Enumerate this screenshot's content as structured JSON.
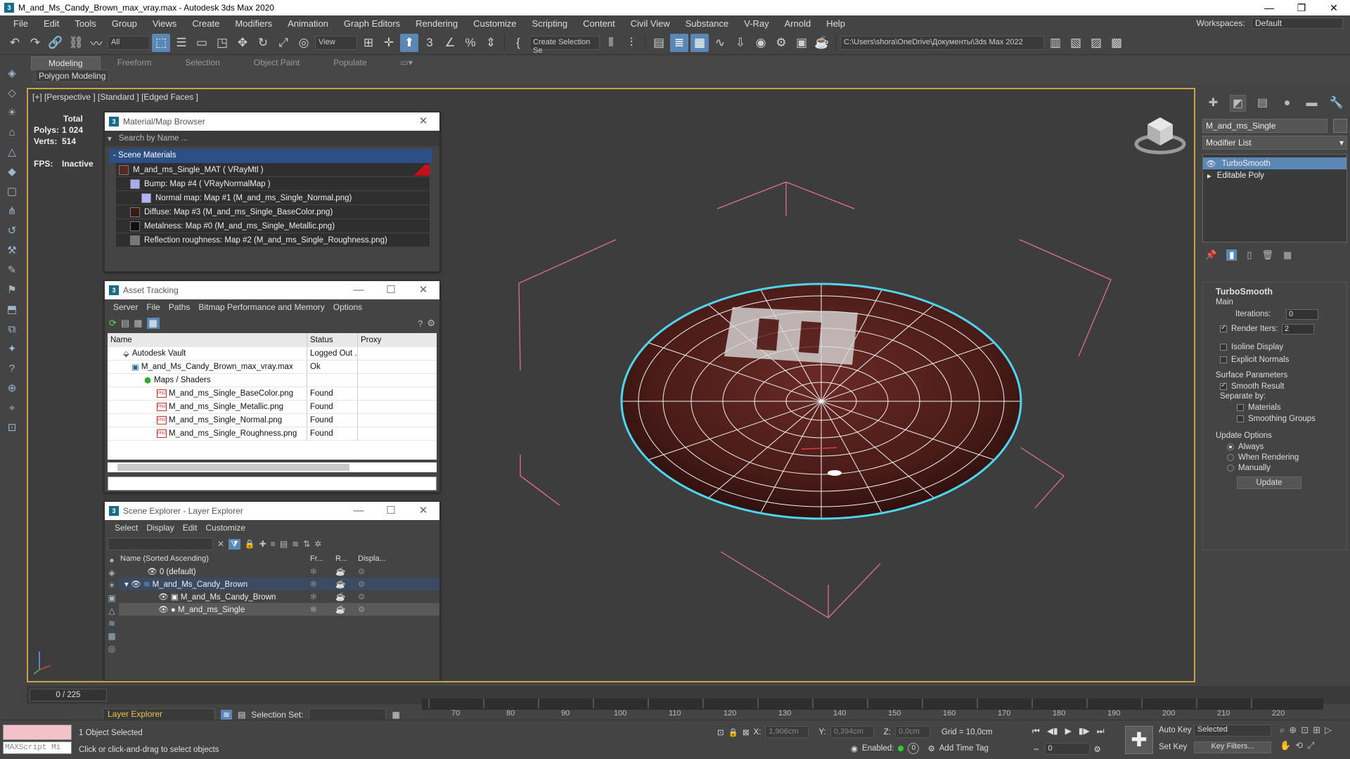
{
  "window": {
    "title": "M_and_Ms_Candy_Brown_max_vray.max - Autodesk 3ds Max 2020",
    "controls": [
      "—",
      "❐",
      "✕"
    ]
  },
  "menu": {
    "items": [
      "File",
      "Edit",
      "Tools",
      "Group",
      "Views",
      "Create",
      "Modifiers",
      "Animation",
      "Graph Editors",
      "Rendering",
      "Customize",
      "Scripting",
      "Content",
      "Civil View",
      "Substance",
      "V-Ray",
      "Arnold",
      "Help"
    ],
    "workspaces_label": "Workspaces:",
    "workspaces_value": "Default"
  },
  "toolbar": {
    "filter": "All",
    "view_select": "View",
    "selection_set": "Create Selection Se",
    "project_path": "C:\\Users\\shora\\OneDrive\\Документы\\3ds Max 2022"
  },
  "ribbon": {
    "tabs": [
      "Modeling",
      "Freeform",
      "Selection",
      "Object Paint",
      "Populate"
    ],
    "subtitle": "Polygon Modeling"
  },
  "viewport": {
    "label": "[+] [Perspective ] [Standard ] [Edged Faces ]",
    "stats": {
      "total_label": "Total",
      "polys_label": "Polys:",
      "polys": "1 024",
      "verts_label": "Verts:",
      "verts": "514",
      "fps_label": "FPS:",
      "fps": "Inactive"
    }
  },
  "material_browser": {
    "title": "Material/Map Browser",
    "search_placeholder": "Search by Name ...",
    "group": "- Scene Materials",
    "rows": [
      {
        "text": "M_and_ms_Single_MAT  ( VRayMtl )",
        "indent": 0,
        "swatch": "#5a2a22"
      },
      {
        "text": "Bump: Map #4  ( VRayNormalMap )",
        "indent": 1,
        "swatch": "#aaaaee"
      },
      {
        "text": "Normal map: Map #1 (M_and_ms_Single_Normal.png)",
        "indent": 2,
        "swatch": "#b3b3ff"
      },
      {
        "text": "Diffuse: Map #3 (M_and_ms_Single_BaseColor.png)",
        "indent": 1,
        "swatch": "#3a1a16"
      },
      {
        "text": "Metalness: Map #0 (M_and_ms_Single_Metallic.png)",
        "indent": 1,
        "swatch": "#111111"
      },
      {
        "text": "Reflection roughness: Map #2 (M_and_ms_Single_Roughness.png)",
        "indent": 1,
        "swatch": "#777777"
      }
    ]
  },
  "asset_tracking": {
    "title": "Asset Tracking",
    "menu": [
      "Server",
      "File",
      "Paths",
      "Bitmap Performance and Memory",
      "Options"
    ],
    "columns": [
      "Name",
      "Status",
      "Proxy"
    ],
    "rows": [
      {
        "name": "Autodesk Vault",
        "status": "Logged Out ...",
        "indent": 1,
        "icon": "vault"
      },
      {
        "name": "M_and_Ms_Candy_Brown_max_vray.max",
        "status": "Ok",
        "indent": 2,
        "icon": "max"
      },
      {
        "name": "Maps / Shaders",
        "status": "",
        "indent": 3,
        "icon": "maps"
      },
      {
        "name": "M_and_ms_Single_BaseColor.png",
        "status": "Found",
        "indent": 4,
        "icon": "png"
      },
      {
        "name": "M_and_ms_Single_Metallic.png",
        "status": "Found",
        "indent": 4,
        "icon": "png"
      },
      {
        "name": "M_and_ms_Single_Normal.png",
        "status": "Found",
        "indent": 4,
        "icon": "png"
      },
      {
        "name": "M_and_ms_Single_Roughness.png",
        "status": "Found",
        "indent": 4,
        "icon": "png"
      }
    ]
  },
  "scene_explorer": {
    "title": "Scene Explorer - Layer Explorer",
    "menu": [
      "Select",
      "Display",
      "Edit",
      "Customize"
    ],
    "columns": [
      "Name (Sorted Ascending)",
      "Fr...",
      "R...",
      "Displa..."
    ],
    "rows": [
      {
        "name": "0 (default)",
        "indent": 0
      },
      {
        "name": "M_and_Ms_Candy_Brown",
        "indent": 0
      },
      {
        "name": "M_and_Ms_Candy_Brown",
        "indent": 1
      },
      {
        "name": "M_and_ms_Single",
        "indent": 1
      }
    ],
    "footer_mode": "Layer Explorer",
    "selection_set_label": "Selection Set:"
  },
  "command_panel": {
    "object_name": "M_and_ms_Single",
    "modifier_list": "Modifier List",
    "stack": [
      "TurboSmooth",
      "Editable Poly"
    ],
    "rollout": "TurboSmooth",
    "main_label": "Main",
    "iterations_label": "Iterations:",
    "iterations": "0",
    "render_iters_label": "Render Iters:",
    "render_iters": "2",
    "isoline": "Isoline Display",
    "explicit_normals": "Explicit Normals",
    "surface_params": "Surface Parameters",
    "smooth_result": "Smooth Result",
    "separate_by": "Separate by:",
    "materials": "Materials",
    "smoothing_groups": "Smoothing Groups",
    "update_options": "Update Options",
    "always": "Always",
    "when_rendering": "When Rendering",
    "manually": "Manually",
    "update_button": "Update"
  },
  "timeline": {
    "frame": "0 / 225",
    "ticks": [
      "70",
      "80",
      "90",
      "100",
      "110",
      "120",
      "130",
      "140",
      "150",
      "160",
      "170",
      "180",
      "190",
      "200",
      "210",
      "220"
    ]
  },
  "status": {
    "maxscript": "MAXScript Mi",
    "selected": "1 Object Selected",
    "hint": "Click or click-and-drag to select objects",
    "x_label": "X:",
    "x": "1,906cm",
    "y_label": "Y:",
    "y": "0,394cm",
    "z_label": "Z:",
    "z": "0,0cm",
    "grid": "Grid = 10,0cm",
    "enabled_label": "Enabled:",
    "add_time_tag": "Add Time Tag",
    "auto_key": "Auto Key",
    "set_key": "Set Key",
    "key_selected": "Selected",
    "key_filters": "Key Filters...",
    "frame_field": "0"
  }
}
